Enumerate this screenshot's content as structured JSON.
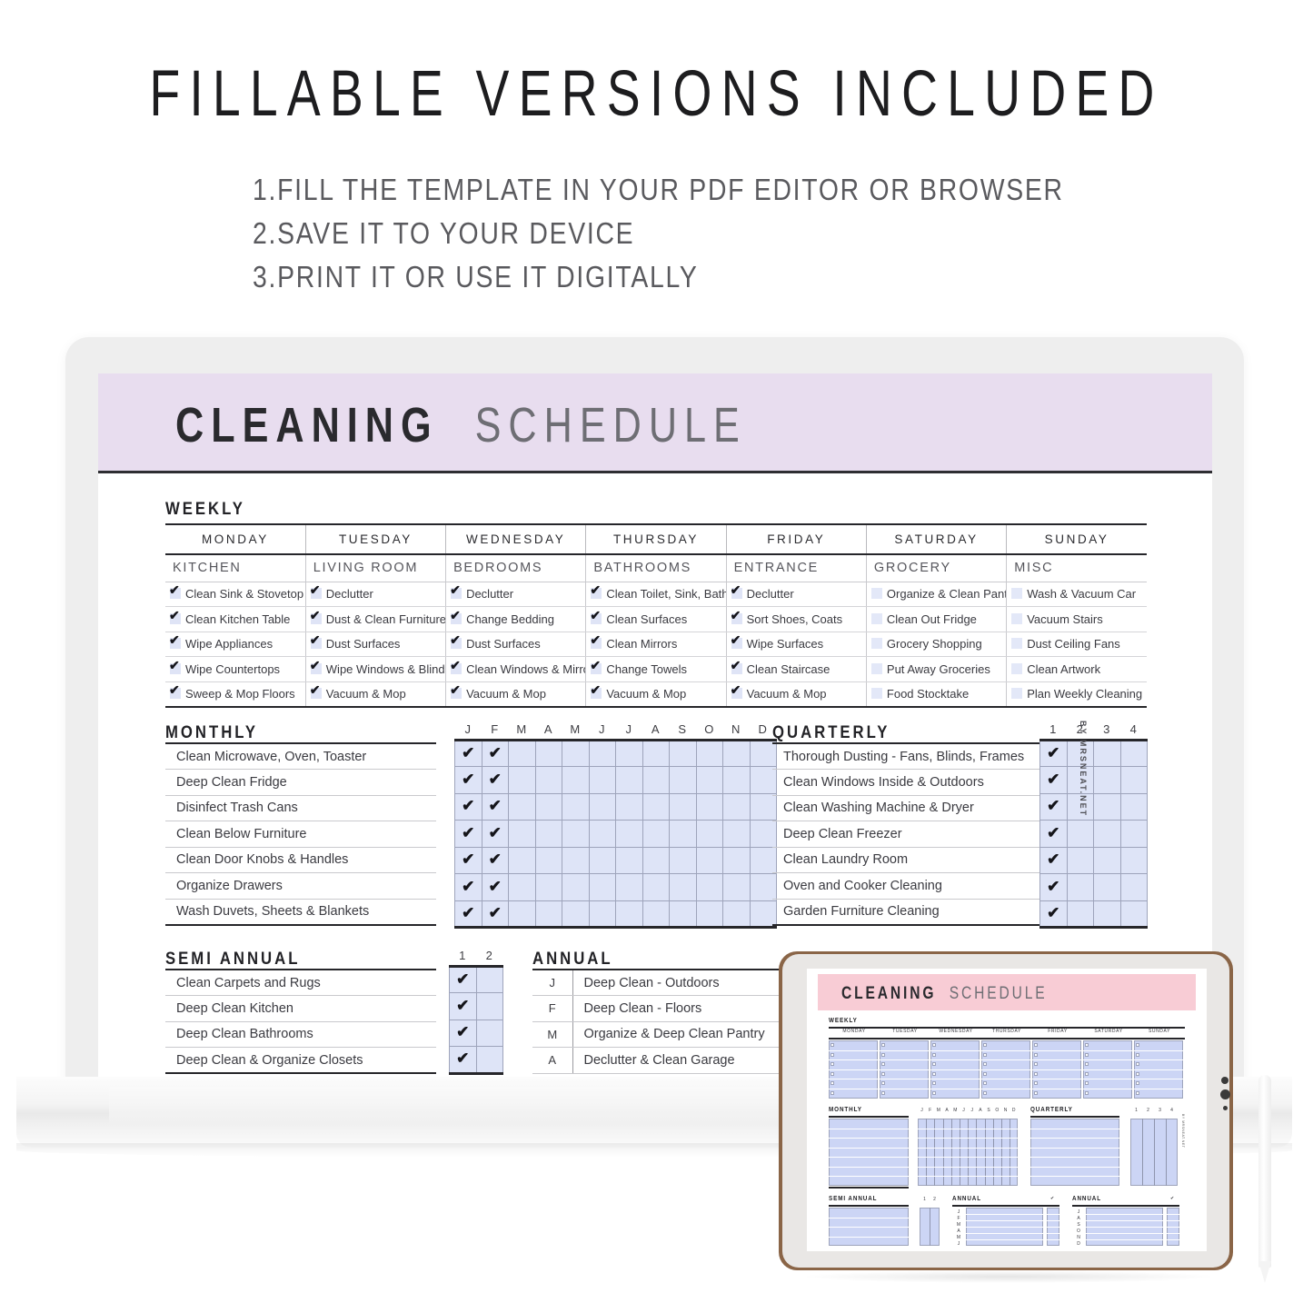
{
  "promo": {
    "title": "FILLABLE VERSIONS INCLUDED",
    "steps": [
      "1.FILL THE TEMPLATE IN YOUR PDF EDITOR OR BROWSER",
      "2.SAVE IT TO YOUR DEVICE",
      "3.PRINT IT OR USE IT DIGITALLY"
    ]
  },
  "sheet": {
    "title_bold": "CLEANING",
    "title_light": "SCHEDULE",
    "header_bg": "#e8ddef",
    "watermark": "BY MRSNEAT.NET",
    "weekly": {
      "label": "WEEKLY",
      "days": [
        "MONDAY",
        "TUESDAY",
        "WEDNESDAY",
        "THURSDAY",
        "FRIDAY",
        "SATURDAY",
        "SUNDAY"
      ],
      "rooms": [
        "KITCHEN",
        "LIVING ROOM",
        "BEDROOMS",
        "BATHROOMS",
        "ENTRANCE",
        "GROCERY",
        "MISC"
      ],
      "columns": [
        {
          "tasks": [
            "Clean Sink & Stovetop",
            "Clean Kitchen Table",
            "Wipe Appliances",
            "Wipe Countertops",
            "Sweep & Mop Floors"
          ],
          "checked": [
            true,
            true,
            true,
            true,
            true
          ]
        },
        {
          "tasks": [
            "Declutter",
            "Dust & Clean Furniture",
            "Dust Surfaces",
            "Wipe Windows & Blinds",
            "Vacuum & Mop"
          ],
          "checked": [
            true,
            true,
            true,
            true,
            true
          ]
        },
        {
          "tasks": [
            "Declutter",
            "Change Bedding",
            "Dust Surfaces",
            "Clean Windows & Mirrors",
            "Vacuum & Mop"
          ],
          "checked": [
            true,
            true,
            true,
            true,
            true
          ]
        },
        {
          "tasks": [
            "Clean Toilet, Sink, Bath",
            "Clean Surfaces",
            "Clean Mirrors",
            "Change Towels",
            "Vacuum & Mop"
          ],
          "checked": [
            true,
            true,
            true,
            true,
            true
          ]
        },
        {
          "tasks": [
            "Declutter",
            "Sort Shoes, Coats",
            "Wipe Surfaces",
            "Clean Staircase",
            "Vacuum & Mop"
          ],
          "checked": [
            true,
            true,
            true,
            true,
            true
          ]
        },
        {
          "tasks": [
            "Organize & Clean Pantry",
            "Clean Out Fridge",
            "Grocery Shopping",
            "Put Away Groceries",
            "Food Stocktake"
          ],
          "checked": [
            false,
            false,
            false,
            false,
            false
          ]
        },
        {
          "tasks": [
            "Wash & Vacuum Car",
            "Vacuum Stairs",
            "Dust Ceiling Fans",
            "Clean Artwork",
            "Plan Weekly Cleaning"
          ],
          "checked": [
            false,
            false,
            false,
            false,
            false
          ]
        }
      ]
    },
    "monthly": {
      "label": "MONTHLY",
      "tasks": [
        "Clean Microwave, Oven, Toaster",
        "Deep Clean Fridge",
        "Disinfect Trash Cans",
        "Clean Below Furniture",
        "Clean Door Knobs & Handles",
        "Organize Drawers",
        "Wash Duvets, Sheets & Blankets"
      ],
      "grid_headers": [
        "J",
        "F",
        "M",
        "A",
        "M",
        "J",
        "J",
        "A",
        "S",
        "O",
        "N",
        "D"
      ],
      "grid_checked_cols": [
        0,
        1
      ]
    },
    "quarterly": {
      "label": "QUARTERLY",
      "tasks": [
        "Thorough Dusting -  Fans, Blinds, Frames",
        "Clean Windows Inside & Outdoors",
        "Clean Washing Machine & Dryer",
        "Deep Clean Freezer",
        "Clean Laundry Room",
        "Oven and Cooker Cleaning",
        "Garden Furniture Cleaning"
      ],
      "grid_headers": [
        "1",
        "2",
        "3",
        "4"
      ],
      "grid_checked_cols": [
        0
      ]
    },
    "semi_annual": {
      "label": "SEMI ANNUAL",
      "tasks": [
        "Clean Carpets and Rugs",
        "Deep Clean Kitchen",
        "Deep Clean Bathrooms",
        "Deep Clean & Organize Closets"
      ],
      "grid_headers": [
        "1",
        "2"
      ],
      "grid_checked_cols": [
        0
      ]
    },
    "annual": {
      "label": "ANNUAL",
      "rows": [
        {
          "month": "J",
          "task": "Deep Clean - Outdoors"
        },
        {
          "month": "F",
          "task": "Deep Clean - Floors"
        },
        {
          "month": "M",
          "task": "Organize & Deep Clean Pantry"
        },
        {
          "month": "A",
          "task": "Declutter & Clean Garage"
        }
      ]
    }
  },
  "tablet": {
    "title_bold": "CLEANING",
    "title_light": "SCHEDULE",
    "header_bg": "#f8ccd5",
    "weekly_label": "WEEKLY",
    "days": [
      "MONDAY",
      "TUESDAY",
      "WEDNESDAY",
      "THURSDAY",
      "FRIDAY",
      "SATURDAY",
      "SUNDAY"
    ],
    "monthly_label": "MONTHLY",
    "quarterly_label": "QUARTERLY",
    "semi_annual_label": "SEMI ANNUAL",
    "annual_label_1": "ANNUAL",
    "annual_label_2": "ANNUAL",
    "monthly_headers": [
      "J",
      "F",
      "M",
      "A",
      "M",
      "J",
      "J",
      "A",
      "S",
      "O",
      "N",
      "D"
    ],
    "quarterly_headers": [
      "1",
      "2",
      "3",
      "4"
    ],
    "semi_headers": [
      "1",
      "2"
    ],
    "annual_months_1": [
      "J",
      "F",
      "M",
      "A",
      "M",
      "J"
    ],
    "annual_months_2": [
      "J",
      "A",
      "S",
      "O",
      "N",
      "D"
    ],
    "watermark": "BY MRSNEAT.NET"
  }
}
